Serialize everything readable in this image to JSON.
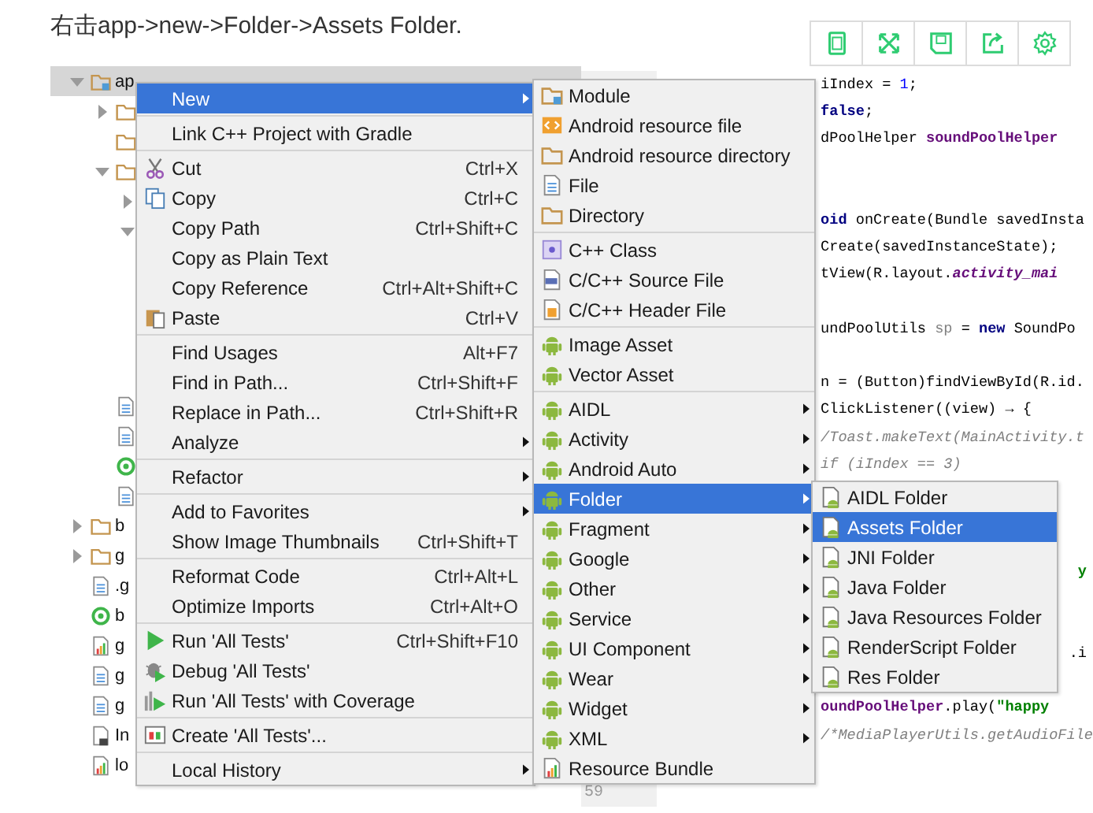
{
  "caption": "右击app->new->Folder->Assets Folder.",
  "toolbar": [
    {
      "kind": "tablet"
    },
    {
      "kind": "expand"
    },
    {
      "kind": "save"
    },
    {
      "kind": "share"
    },
    {
      "kind": "settings"
    }
  ],
  "tree": [
    {
      "label": "ap",
      "kind": "module",
      "expanded": true,
      "selected": true,
      "children": [
        {
          "kind": "folder",
          "expanded": false,
          "selected": false
        },
        {
          "kind": "folder",
          "selected": false
        },
        {
          "kind": "folder",
          "expanded": true,
          "selected": false,
          "children": [
            {
              "expanded": false,
              "selected": false
            },
            {
              "expanded": true,
              "selected": false
            }
          ]
        },
        {
          "kind": "file",
          "selected": false
        },
        {
          "kind": "file",
          "selected": false
        },
        {
          "kind": "ring",
          "selected": false
        },
        {
          "kind": "file",
          "selected": false
        }
      ]
    },
    {
      "label": "b",
      "kind": "folder",
      "expanded": false,
      "selected": false
    },
    {
      "label": "g",
      "kind": "folder",
      "expanded": false,
      "selected": false
    },
    {
      "label": ".g",
      "kind": "file",
      "selected": false
    },
    {
      "label": "b",
      "kind": "ring",
      "selected": false
    },
    {
      "label": "g",
      "kind": "chart",
      "selected": false
    },
    {
      "label": "g",
      "kind": "file",
      "selected": false
    },
    {
      "label": "g",
      "kind": "file",
      "selected": false
    },
    {
      "label": "In",
      "kind": "lockfile",
      "selected": false
    },
    {
      "label": "lo",
      "kind": "chart",
      "selected": false
    }
  ],
  "code": [
    {
      "kind": "line",
      "segments": [
        {
          "kind": "plain",
          "text": "iIndex = "
        },
        {
          "kind": "number",
          "text": "1"
        },
        {
          "kind": "plain",
          "text": ";"
        }
      ]
    },
    {
      "kind": "line",
      "segments": [
        {
          "kind": "keyword",
          "text": "false"
        },
        {
          "kind": "plain",
          "text": ";"
        }
      ]
    },
    {
      "kind": "line",
      "segments": [
        {
          "kind": "plain",
          "text": "dPoolHelper "
        },
        {
          "kind": "field",
          "text": "soundPoolHelper"
        }
      ]
    },
    {
      "kind": "blank"
    },
    {
      "kind": "blank"
    },
    {
      "kind": "line",
      "segments": [
        {
          "kind": "keyword",
          "text": "oid"
        },
        {
          "kind": "plain",
          "text": " onCreate(Bundle savedInsta"
        }
      ]
    },
    {
      "kind": "line",
      "segments": [
        {
          "kind": "plain",
          "text": "Create(savedInstanceState);"
        }
      ]
    },
    {
      "kind": "line",
      "segments": [
        {
          "kind": "plain",
          "text": "tView(R.layout."
        },
        {
          "kind": "static",
          "text": "activity_mai"
        }
      ]
    },
    {
      "kind": "blank"
    },
    {
      "kind": "line",
      "segments": [
        {
          "kind": "plain",
          "text": "undPoolUtils "
        },
        {
          "kind": "unused",
          "text": "sp"
        },
        {
          "kind": "plain",
          "text": " = "
        },
        {
          "kind": "keyword",
          "text": "new"
        },
        {
          "kind": "plain",
          "text": " SoundPo"
        }
      ]
    },
    {
      "kind": "blank"
    },
    {
      "kind": "line",
      "segments": [
        {
          "kind": "plain",
          "text": "n = (Button)findViewById(R.id."
        }
      ]
    },
    {
      "kind": "line",
      "segments": [
        {
          "kind": "plain",
          "text": "ClickListener((view) → {"
        }
      ]
    },
    {
      "kind": "line",
      "segments": [
        {
          "kind": "comment",
          "text": "/Toast.makeText(MainActivity.t"
        }
      ]
    },
    {
      "kind": "line",
      "segments": [
        {
          "kind": "comment",
          "text": "if (iIndex == 3)"
        }
      ]
    },
    {
      "kind": "blank"
    },
    {
      "kind": "blank"
    },
    {
      "kind": "blank"
    },
    {
      "kind": "fragment",
      "segments": [
        {
          "kind": "string",
          "text": "y"
        }
      ]
    },
    {
      "kind": "blank"
    },
    {
      "kind": "blank"
    },
    {
      "kind": "fragment",
      "segments": [
        {
          "kind": "plain",
          "text": ".i"
        }
      ]
    },
    {
      "kind": "blank"
    },
    {
      "kind": "line",
      "segments": [
        {
          "kind": "field",
          "text": "oundPoolHelper"
        },
        {
          "kind": "plain",
          "text": ".play("
        },
        {
          "kind": "string",
          "text": "\"happy"
        }
      ]
    },
    {
      "kind": "line",
      "segments": [
        {
          "kind": "comment",
          "text": "/*MediaPlayerUtils.getAudioFile"
        }
      ]
    },
    {
      "kind": "blank"
    },
    {
      "kind": "blank",
      "number": "59"
    }
  ],
  "context_menu": [
    {
      "kind": "text",
      "label": "New",
      "submenu": true,
      "selected": true
    },
    {
      "kind": "separator"
    },
    {
      "kind": "text",
      "label": "Link C++ Project with Gradle",
      "selected": false
    },
    {
      "kind": "separator"
    },
    {
      "kind": "scissors",
      "label": "Cut",
      "shortcut": "Ctrl+X",
      "selected": false
    },
    {
      "kind": "copy",
      "label": "Copy",
      "shortcut": "Ctrl+C",
      "selected": false
    },
    {
      "kind": "text",
      "label": "Copy Path",
      "shortcut": "Ctrl+Shift+C",
      "selected": false
    },
    {
      "kind": "text",
      "label": "Copy as Plain Text",
      "selected": false
    },
    {
      "kind": "text",
      "label": "Copy Reference",
      "shortcut": "Ctrl+Alt+Shift+C",
      "selected": false
    },
    {
      "kind": "paste",
      "label": "Paste",
      "shortcut": "Ctrl+V",
      "selected": false
    },
    {
      "kind": "separator"
    },
    {
      "kind": "text",
      "label": "Find Usages",
      "shortcut": "Alt+F7",
      "selected": false
    },
    {
      "kind": "text",
      "label": "Find in Path...",
      "shortcut": "Ctrl+Shift+F",
      "selected": false
    },
    {
      "kind": "text",
      "label": "Replace in Path...",
      "shortcut": "Ctrl+Shift+R",
      "selected": false
    },
    {
      "kind": "text",
      "label": "Analyze",
      "submenu": true,
      "selected": false
    },
    {
      "kind": "separator"
    },
    {
      "kind": "text",
      "label": "Refactor",
      "submenu": true,
      "selected": false
    },
    {
      "kind": "separator"
    },
    {
      "kind": "text",
      "label": "Add to Favorites",
      "submenu": true,
      "selected": false
    },
    {
      "kind": "text",
      "label": "Show Image Thumbnails",
      "shortcut": "Ctrl+Shift+T",
      "selected": false
    },
    {
      "kind": "separator"
    },
    {
      "kind": "text",
      "label": "Reformat Code",
      "shortcut": "Ctrl+Alt+L",
      "selected": false
    },
    {
      "kind": "text",
      "label": "Optimize Imports",
      "shortcut": "Ctrl+Alt+O",
      "selected": false
    },
    {
      "kind": "separator"
    },
    {
      "kind": "run",
      "label": "Run 'All Tests'",
      "shortcut": "Ctrl+Shift+F10",
      "selected": false
    },
    {
      "kind": "debug",
      "label": "Debug 'All Tests'",
      "selected": false
    },
    {
      "kind": "coverage",
      "label": "Run 'All Tests' with Coverage",
      "selected": false
    },
    {
      "kind": "separator"
    },
    {
      "kind": "window",
      "label": "Create 'All Tests'...",
      "selected": false
    },
    {
      "kind": "separator"
    },
    {
      "kind": "text",
      "label": "Local History",
      "submenu": true,
      "selected": false
    }
  ],
  "new_submenu": [
    {
      "kind": "module",
      "label": "Module",
      "selected": false
    },
    {
      "kind": "resfile",
      "label": "Android resource file",
      "selected": false
    },
    {
      "kind": "folder",
      "label": "Android resource directory",
      "selected": false
    },
    {
      "kind": "file",
      "label": "File",
      "selected": false
    },
    {
      "kind": "folder",
      "label": "Directory",
      "selected": false
    },
    {
      "kind": "separator"
    },
    {
      "kind": "cppclass",
      "label": "C++ Class",
      "selected": false
    },
    {
      "kind": "cppsource",
      "label": "C/C++ Source File",
      "selected": false
    },
    {
      "kind": "cppheader",
      "label": "C/C++ Header File",
      "selected": false
    },
    {
      "kind": "separator"
    },
    {
      "kind": "android",
      "label": "Image Asset",
      "selected": false
    },
    {
      "kind": "android",
      "label": "Vector Asset",
      "selected": false
    },
    {
      "kind": "separator"
    },
    {
      "kind": "android",
      "label": "AIDL",
      "submenu": true,
      "selected": false
    },
    {
      "kind": "android",
      "label": "Activity",
      "submenu": true,
      "selected": false
    },
    {
      "kind": "android",
      "label": "Android Auto",
      "submenu": true,
      "selected": false
    },
    {
      "kind": "android",
      "label": "Folder",
      "submenu": true,
      "selected": true
    },
    {
      "kind": "android",
      "label": "Fragment",
      "submenu": true,
      "selected": false
    },
    {
      "kind": "android",
      "label": "Google",
      "submenu": true,
      "selected": false
    },
    {
      "kind": "android",
      "label": "Other",
      "submenu": true,
      "selected": false
    },
    {
      "kind": "android",
      "label": "Service",
      "submenu": true,
      "selected": false
    },
    {
      "kind": "android",
      "label": "UI Component",
      "submenu": true,
      "selected": false
    },
    {
      "kind": "android",
      "label": "Wear",
      "submenu": true,
      "selected": false
    },
    {
      "kind": "android",
      "label": "Widget",
      "submenu": true,
      "selected": false
    },
    {
      "kind": "android",
      "label": "XML",
      "submenu": true,
      "selected": false
    },
    {
      "kind": "chart",
      "label": "Resource Bundle",
      "selected": false
    }
  ],
  "folder_submenu": [
    {
      "kind": "andfolder",
      "label": "AIDL Folder",
      "selected": false
    },
    {
      "kind": "andfolder",
      "label": "Assets Folder",
      "selected": true
    },
    {
      "kind": "andfolder",
      "label": "JNI Folder",
      "selected": false
    },
    {
      "kind": "andfolder",
      "label": "Java Folder",
      "selected": false
    },
    {
      "kind": "andfolder",
      "label": "Java Resources Folder",
      "selected": false
    },
    {
      "kind": "andfolder",
      "label": "RenderScript Folder",
      "selected": false
    },
    {
      "kind": "andfolder",
      "label": "Res Folder",
      "selected": false
    }
  ]
}
